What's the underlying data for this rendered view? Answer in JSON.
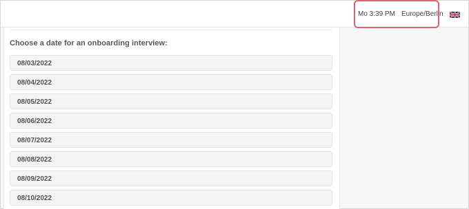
{
  "header": {
    "time": "Mo 3:39 PM",
    "timezone": "Europe/Berlin",
    "language_icon": "uk-flag-icon"
  },
  "main": {
    "question": "Choose a date for an onboarding interview:",
    "dates": [
      "08/03/2022",
      "08/04/2022",
      "08/05/2022",
      "08/06/2022",
      "08/07/2022",
      "08/08/2022",
      "08/09/2022",
      "08/10/2022"
    ]
  },
  "colors": {
    "highlight_border": "#e06070",
    "date_button_bg": "#f4f4f4",
    "text": "#505156"
  }
}
